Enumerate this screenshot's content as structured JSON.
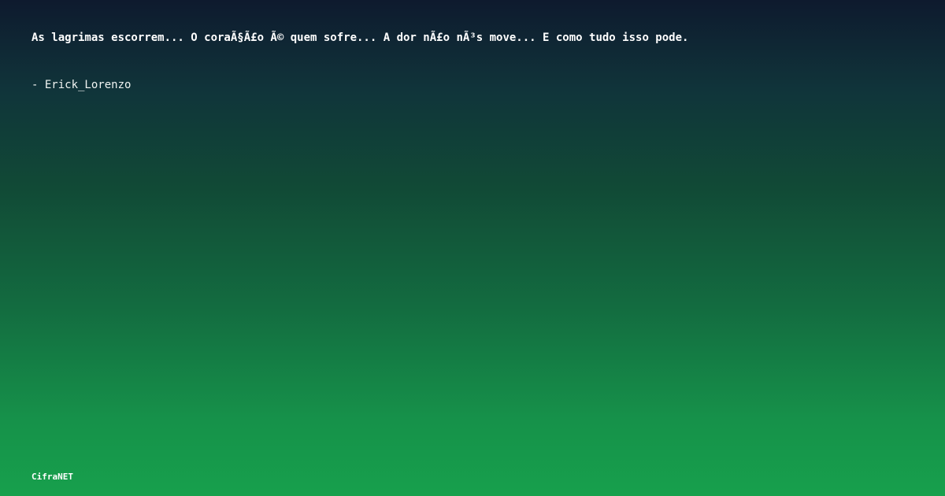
{
  "quote": {
    "text": "As lagrimas escorrem... O coraÃ§Ã£o Ã© quem sofre... A dor nÃ£o nÃ³s move... E como tudo isso pode.",
    "author_line": "- Erick_Lorenzo"
  },
  "brand": {
    "name": "CifraNET"
  },
  "colors": {
    "gradient_top": "#0e1a2e",
    "gradient_bottom": "#17a04c",
    "text": "#ffffff"
  }
}
